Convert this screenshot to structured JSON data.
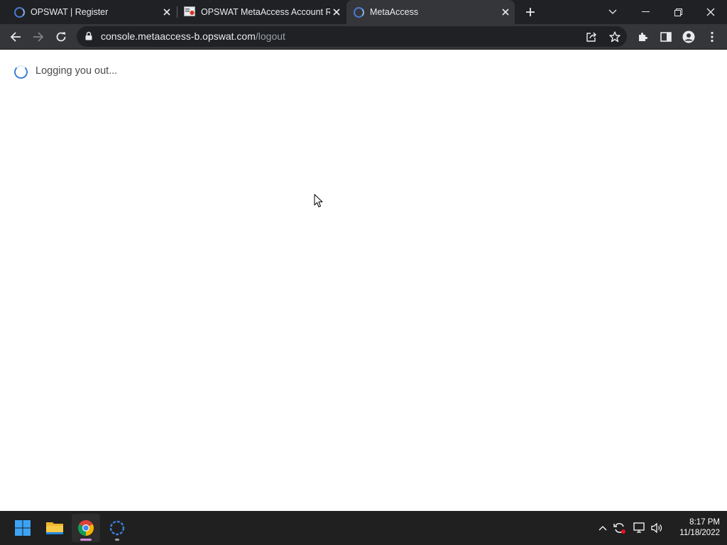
{
  "browser": {
    "tabs": [
      {
        "title": "OPSWAT | Register",
        "icon": "spinner-favicon"
      },
      {
        "title": "OPSWAT MetaAccess Account Re",
        "icon": "document-favicon"
      },
      {
        "title": "MetaAccess",
        "icon": "spinner-favicon",
        "active": true
      }
    ],
    "address": {
      "domain": "console.metaaccess-b.opswat.com",
      "path": "/logout"
    }
  },
  "page": {
    "message": "Logging you out..."
  },
  "taskbar": {
    "apps": [
      "windows-start",
      "file-explorer",
      "chrome",
      "metaaccess"
    ],
    "clock": {
      "time": "8:17 PM",
      "date": "11/18/2022"
    }
  },
  "colors": {
    "accent": "#3d7fd9",
    "tabstrip": "#202124",
    "toolbar": "#35363a",
    "taskbar": "#202020"
  }
}
